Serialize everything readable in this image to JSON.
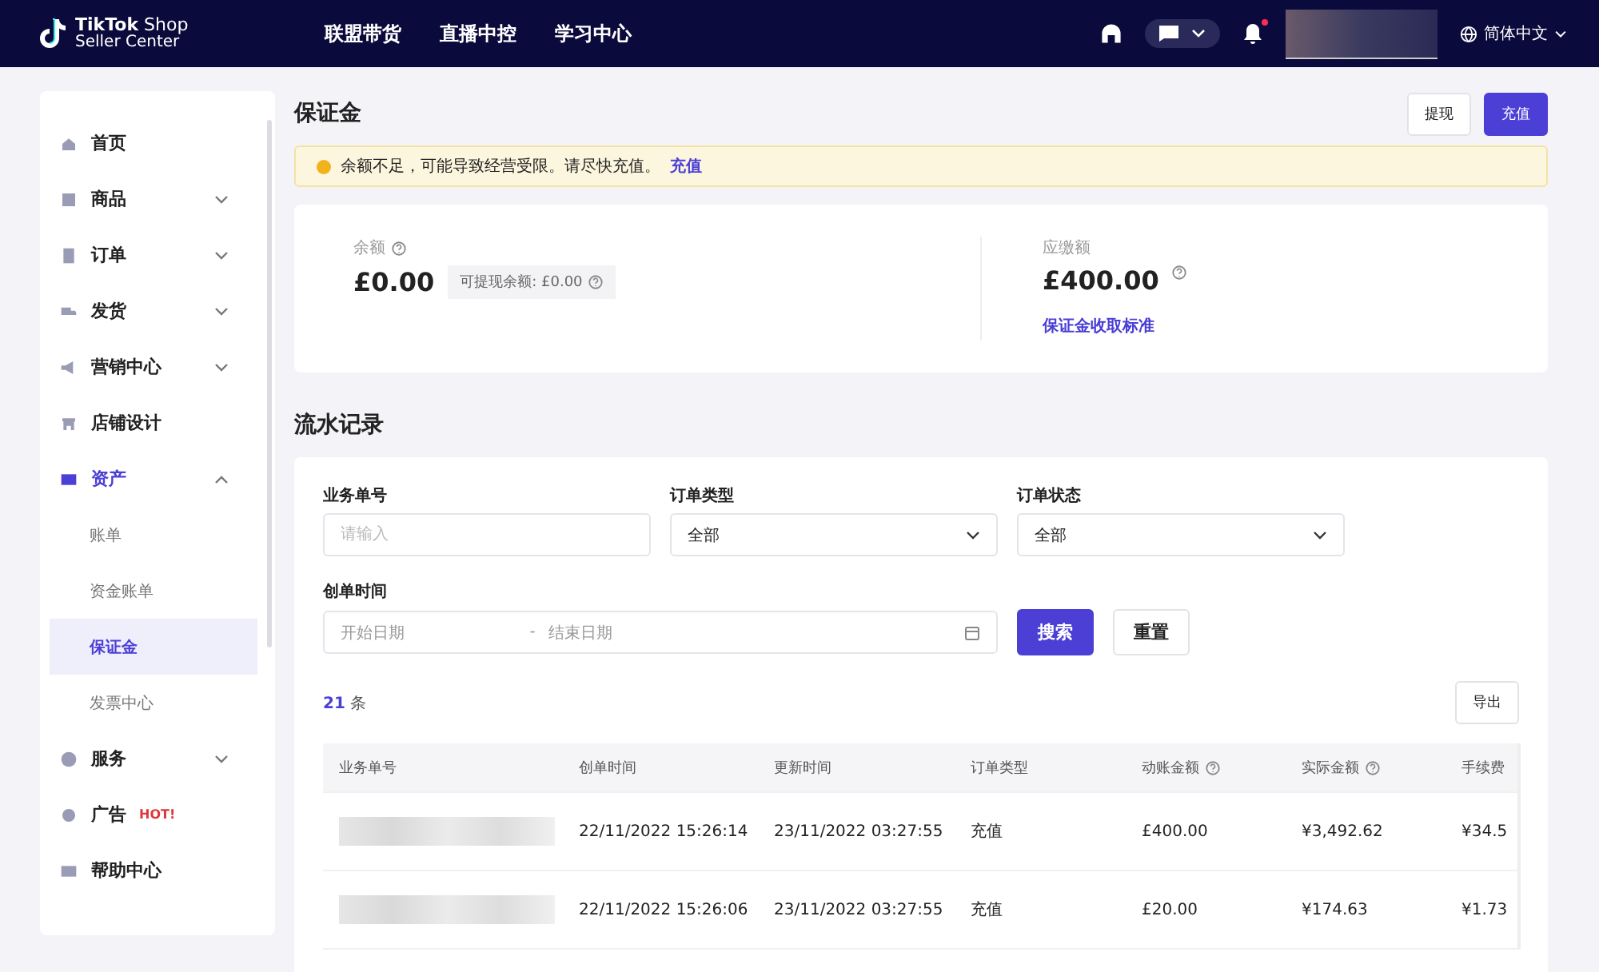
{
  "topbar": {
    "logo_line1": "TikTok",
    "logo_line1b": "Shop",
    "logo_line2": "Seller Center",
    "nav": [
      {
        "label": "联盟带货"
      },
      {
        "label": "直播中控"
      },
      {
        "label": "学习中心"
      }
    ],
    "notification_dot": true,
    "language": "简体中文"
  },
  "sidebar": {
    "items": [
      {
        "label": "首页",
        "selected": false
      },
      {
        "label": "商品",
        "selected": false,
        "expanded": false
      },
      {
        "label": "订单",
        "selected": false,
        "expanded": false
      },
      {
        "label": "发货",
        "selected": false,
        "expanded": false
      },
      {
        "label": "营销中心",
        "selected": false,
        "expanded": false
      },
      {
        "label": "店铺设计",
        "selected": false
      },
      {
        "label": "资产",
        "selected": true,
        "expanded": true,
        "children": [
          {
            "label": "账单",
            "selected": false
          },
          {
            "label": "资金账单",
            "selected": false
          },
          {
            "label": "保证金",
            "selected": true
          },
          {
            "label": "发票中心",
            "selected": false
          }
        ]
      },
      {
        "label": "服务",
        "selected": false,
        "expanded": false
      },
      {
        "label": "广告",
        "selected": false,
        "badge": "HOT!"
      },
      {
        "label": "帮助中心",
        "selected": false
      }
    ]
  },
  "page": {
    "title": "保证金",
    "buttons": [
      {
        "label": "提现",
        "kind": "secondary"
      },
      {
        "label": "充值",
        "kind": "primary"
      }
    ],
    "alert": {
      "text": "余额不足，可能导致经营受限。请尽快充值。",
      "link": "充值"
    },
    "balance": {
      "label": "余额",
      "amount": "£0.00",
      "withdrawable": "可提现余额: £0.00"
    },
    "due": {
      "label": "应缴额",
      "amount": "£400.00",
      "link": "保证金收取标准"
    }
  },
  "records": {
    "title": "流水记录",
    "filters": [
      {
        "label": "业务单号",
        "kind": "input",
        "placeholder": "请输入"
      },
      {
        "label": "订单类型",
        "kind": "select",
        "value": "全部"
      },
      {
        "label": "订单状态",
        "kind": "select",
        "value": "全部"
      }
    ],
    "date": {
      "label": "创单时间",
      "start_placeholder": "开始日期",
      "separator": "-",
      "end_placeholder": "结束日期"
    },
    "search_button": "搜索",
    "reset_button": "重置",
    "count": "21",
    "count_unit": "条",
    "export_button": "导出",
    "table": {
      "columns": [
        {
          "label": "业务单号",
          "info": false
        },
        {
          "label": "创单时间",
          "info": false
        },
        {
          "label": "更新时间",
          "info": false
        },
        {
          "label": "订单类型",
          "info": false
        },
        {
          "label": "动账金额",
          "info": true
        },
        {
          "label": "实际金额",
          "info": true
        },
        {
          "label": "手续费",
          "info": false
        }
      ],
      "rows": [
        {
          "created": "22/11/2022 15:26:14",
          "updated": "23/11/2022 03:27:55",
          "type": "充值",
          "amount": "£400.00",
          "actual": "¥3,492.62",
          "fee": "¥34.5"
        },
        {
          "created": "22/11/2022 15:26:06",
          "updated": "23/11/2022 03:27:55",
          "type": "充值",
          "amount": "£20.00",
          "actual": "¥174.63",
          "fee": "¥1.73"
        }
      ]
    }
  }
}
